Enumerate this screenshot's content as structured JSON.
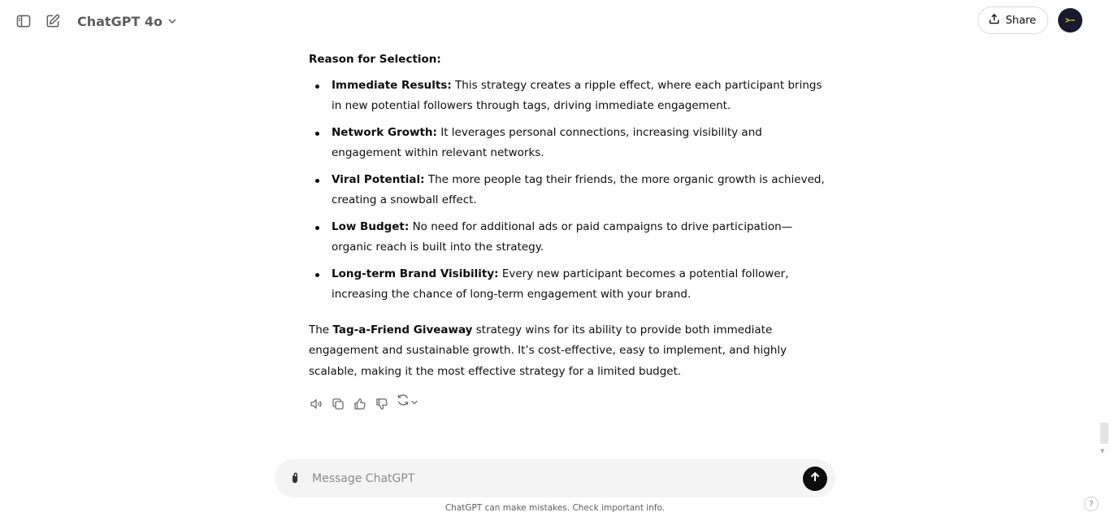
{
  "header": {
    "model_name": "ChatGPT 4o",
    "share_label": "Share",
    "avatar_text": ">−"
  },
  "message": {
    "section_heading": "Reason for Selection:",
    "points": [
      {
        "title": "Immediate Results:",
        "text": " This strategy creates a ripple effect, where each participant brings in new potential followers through tags, driving immediate engagement."
      },
      {
        "title": "Network Growth:",
        "text": " It leverages personal connections, increasing visibility and engagement within relevant networks."
      },
      {
        "title": "Viral Potential:",
        "text": " The more people tag their friends, the more organic growth is achieved, creating a snowball effect."
      },
      {
        "title": "Low Budget:",
        "text": " No need for additional ads or paid campaigns to drive participation—organic reach is built into the strategy."
      },
      {
        "title": "Long-term Brand Visibility:",
        "text": " Every new participant becomes a potential follower, increasing the chance of long-term engagement with your brand."
      }
    ],
    "summary_prefix": "The ",
    "summary_bold": "Tag-a-Friend Giveaway",
    "summary_suffix": " strategy wins for its ability to provide both immediate engagement and sustainable growth. It’s cost-effective, easy to implement, and highly scalable, making it the most effective strategy for a limited budget."
  },
  "composer": {
    "placeholder": "Message ChatGPT"
  },
  "footer": {
    "disclaimer": "ChatGPT can make mistakes. Check important info.",
    "help_label": "?"
  },
  "icons": {
    "sidebar_toggle": "sidebar-icon",
    "new_chat": "edit-icon",
    "model_chevron": "chevron-down-icon",
    "share": "upload-icon",
    "read_aloud": "speaker-icon",
    "copy": "copy-icon",
    "good_response": "thumbs-up-icon",
    "bad_response": "thumbs-down-icon",
    "regenerate": "refresh-icon",
    "attach": "paperclip-icon",
    "send": "arrow-up-icon"
  },
  "colors": {
    "text": "#0d0d0d",
    "muted": "#5d5d5d",
    "composer_bg": "#f4f4f4",
    "send_bg": "#0d0d0d",
    "avatar_bg": "#1a1a2e",
    "avatar_fg": "#f5d547"
  }
}
